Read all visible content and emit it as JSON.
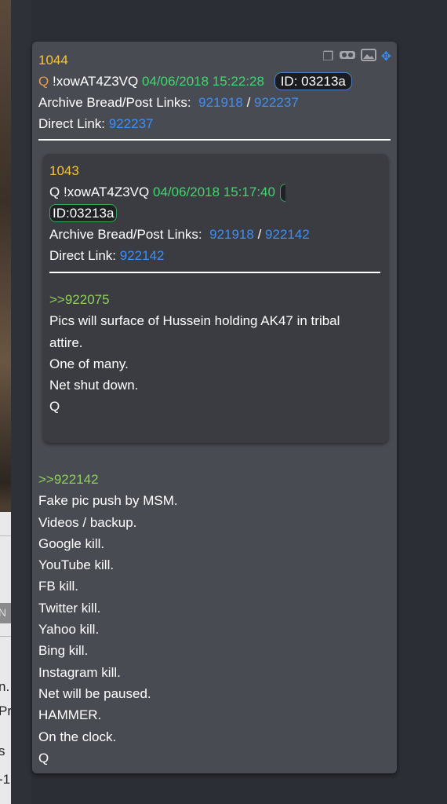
{
  "outer_post": {
    "number": "1044",
    "author": "Q",
    "tripcode": "!xowAT4Z3VQ",
    "timestamp": "04/06/2018 15:22:28",
    "id_label": "ID: 03213a",
    "archive_label": "Archive Bread/Post Links:",
    "archive_link_1": "921918",
    "archive_sep": "/",
    "archive_link_2": "922237",
    "direct_label": "Direct Link:",
    "direct_link": "922237",
    "reply_ref": ">>922142",
    "lines": [
      "Fake pic push by MSM.",
      "Videos / backup.",
      "Google kill.",
      "YouTube kill.",
      "FB kill.",
      "Twitter kill.",
      "Yahoo kill.",
      "Bing kill.",
      "Instagram kill.",
      "Net will be paused.",
      "HAMMER.",
      "On the clock.",
      "Q"
    ]
  },
  "quoted_post": {
    "number": "1043",
    "author": "Q",
    "tripcode": "!xowAT4Z3VQ",
    "timestamp": "04/06/2018 15:17:40",
    "id_label": "ID:03213a",
    "archive_label": "Archive Bread/Post Links:",
    "archive_link_1": "921918",
    "archive_sep": "/",
    "archive_link_2": "922142",
    "direct_label": "Direct Link:",
    "direct_link": "922142",
    "reply_ref": ">>922075",
    "lines": [
      "Pics will surface of Hussein holding AK47 in tribal",
      "attire.",
      "One of many.",
      "Net shut down.",
      "Q"
    ]
  },
  "toolbar_icons": [
    "copy-icon",
    "vr-goggles-icon",
    "image-icon",
    "move-icon"
  ],
  "background_fragments": [
    "n.",
    "Pr",
    "s",
    "-1",
    "N"
  ],
  "colors": {
    "post_number": "#f5c536",
    "author": "#e89a4f",
    "timestamp": "#3fd66e",
    "link": "#3d8ef5",
    "reply_ref": "#8fd05b",
    "card_bg": "#494b52",
    "inner_bg": "#3b3c41"
  }
}
